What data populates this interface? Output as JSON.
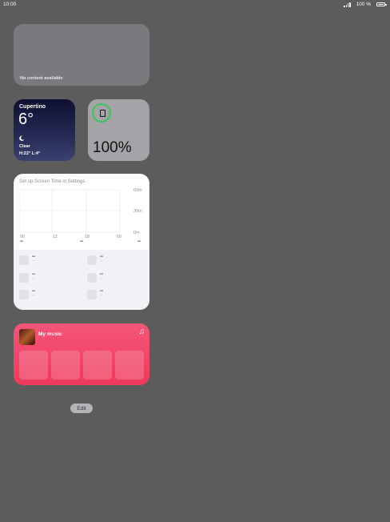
{
  "status_bar": {
    "time": "10:00",
    "battery_text": "100 %"
  },
  "empty_widget": {
    "message": "No content available"
  },
  "weather": {
    "city": "Cupertino",
    "temperature": "6°",
    "condition": "Clear",
    "high_low": "H:22° L:4°",
    "condition_icon": "moon-icon"
  },
  "battery_widget": {
    "percentage": "100%",
    "device_icon": "ipad-icon",
    "ring_color": "#34c759"
  },
  "screen_time": {
    "hint": "Set up Screen Time in Settings.",
    "y_labels": [
      "60m",
      "30m",
      "0m"
    ],
    "x_labels": [
      "06",
      "12",
      "18",
      "00"
    ],
    "totals": [
      "--",
      "--",
      "--"
    ],
    "apps": [
      {
        "name": "--",
        "time": "--"
      },
      {
        "name": "--",
        "time": "--"
      },
      {
        "name": "--",
        "time": "--"
      },
      {
        "name": "--",
        "time": "--"
      },
      {
        "name": "--",
        "time": "--"
      },
      {
        "name": "--",
        "time": "--"
      }
    ]
  },
  "music": {
    "title": "My music",
    "icon": "music-note-icon",
    "accent": "#ee3a5c"
  },
  "edit_button": {
    "label": "Edit"
  }
}
